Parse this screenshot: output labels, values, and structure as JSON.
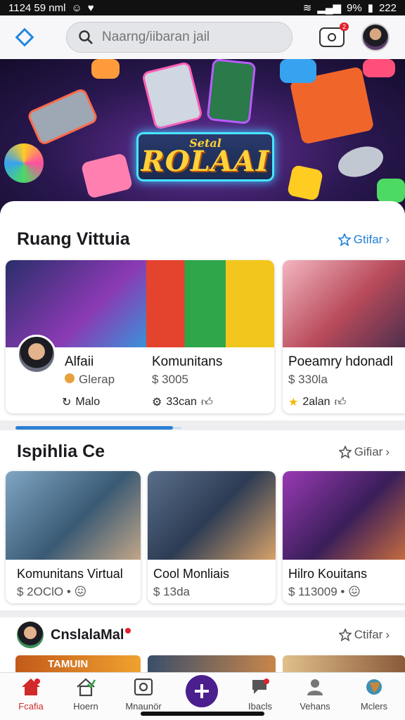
{
  "status_bar": {
    "time": "1124 59 nml",
    "battery": "9%",
    "clock": "222"
  },
  "header": {
    "search_placeholder": "Naarng/iibaran jail",
    "notification_count": "2"
  },
  "banner": {
    "kicker": "Setal",
    "title": "ROLAAI"
  },
  "section1": {
    "title": "Ruang Vittuia",
    "action": "Gtifar",
    "cards": [
      {
        "title": "Alfaii",
        "sub": "Glerap",
        "meta": "Malo"
      },
      {
        "title": "Komunitans",
        "sub": "$ 3005",
        "meta": "33can"
      },
      {
        "title": "Poeamry hdonadl",
        "sub": "$ 330la",
        "meta": "2alan"
      }
    ]
  },
  "section2": {
    "title": "Ispihlia Ce",
    "action": "Gifiar",
    "cards": [
      {
        "title": "Komunitans Virtual",
        "sub": "$ 2OClO •"
      },
      {
        "title": "Cool Monliais",
        "sub": "$ 13da"
      },
      {
        "title": "Hilro Kouitans",
        "sub": "$ 113009 •"
      }
    ]
  },
  "section3": {
    "title": "CnslalaMal",
    "action": "Ctifar",
    "thumb_text": "TAMUIN"
  },
  "bottom_nav": [
    {
      "label": "Fcafia"
    },
    {
      "label": "Hoern"
    },
    {
      "label": "Mnaunör"
    },
    {
      "label": "Ibacls"
    },
    {
      "label": "Vehans"
    },
    {
      "label": "Mclers"
    }
  ],
  "colors": {
    "accent": "#1f7ed6",
    "fab": "#4b1f8e",
    "active_nav": "#d12a2a",
    "badge": "#e0232e"
  }
}
